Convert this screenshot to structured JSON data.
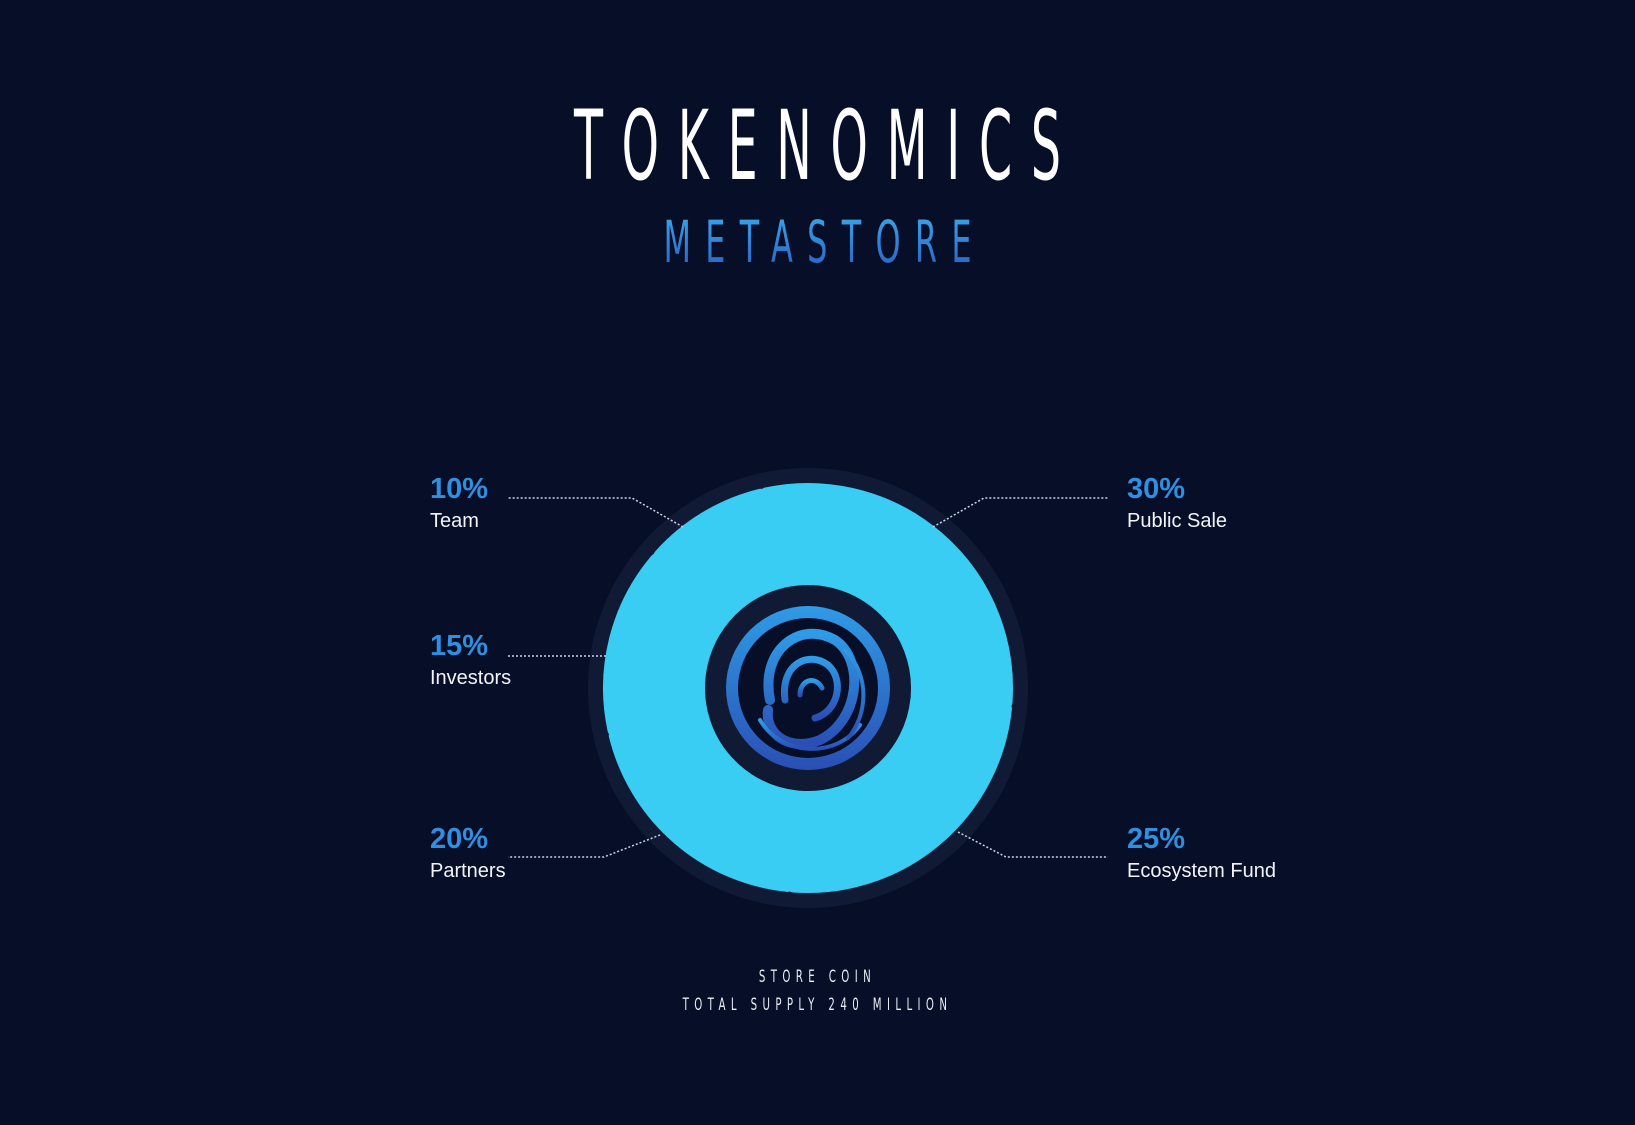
{
  "header": {
    "title": "TOKENOMICS",
    "subtitle": "METASTORE"
  },
  "footer": {
    "line1": "STORE COIN",
    "line2": "TOTAL SUPPLY 240 MILLION"
  },
  "colors": {
    "background": "#070f28",
    "ring_track": "#101a35",
    "segment": "#39cdf4",
    "percent_text": "#2f8fe0",
    "label_text": "#f2f4f8",
    "leader_line": "#c9d3e6",
    "logo_gradient_start": "#2f9be6",
    "logo_gradient_end": "#2a4fb5"
  },
  "center_logo": {
    "icon": "swirl-coin-icon"
  },
  "labels": [
    {
      "percent": "10%",
      "name": "Team"
    },
    {
      "percent": "15%",
      "name": "Investors"
    },
    {
      "percent": "20%",
      "name": "Partners"
    },
    {
      "percent": "30%",
      "name": "Public Sale"
    },
    {
      "percent": "25%",
      "name": "Ecosystem Fund"
    }
  ],
  "chart_data": {
    "type": "pie",
    "style": "donut",
    "categories": [
      "Public Sale",
      "Ecosystem Fund",
      "Partners",
      "Investors",
      "Team"
    ],
    "values": [
      30,
      25,
      20,
      15,
      10
    ],
    "unit": "%"
  }
}
